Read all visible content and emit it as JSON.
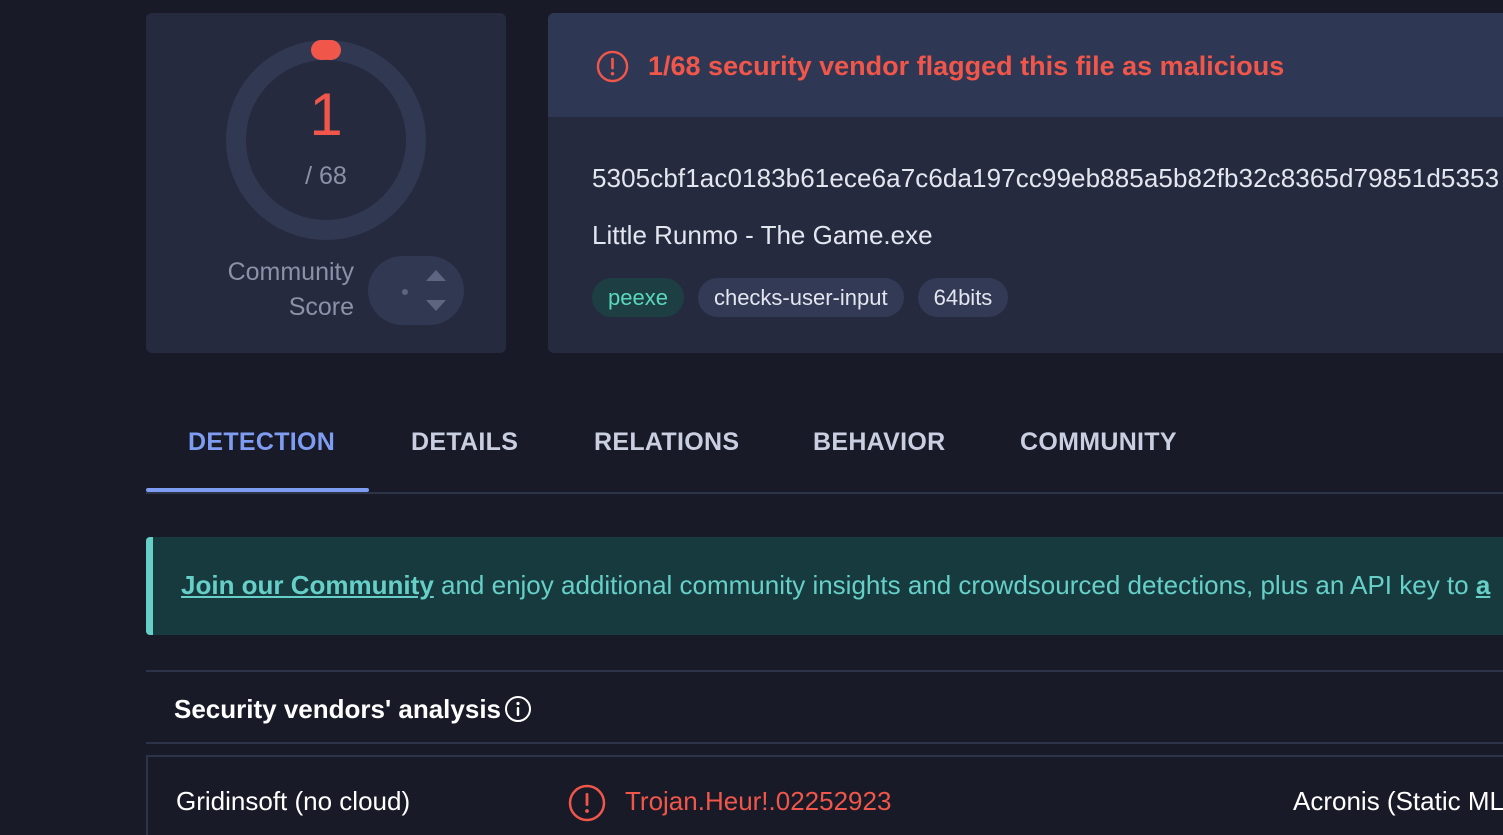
{
  "score": {
    "detections": "1",
    "total": "/ 68",
    "community_label_line1": "Community",
    "community_label_line2": "Score",
    "ring_color": "#f0564a"
  },
  "file": {
    "alert_text": "1/68 security vendor flagged this file as malicious",
    "hash": "5305cbf1ac0183b61ece6a7c6da197cc99eb885a5b82fb32c8365d79851d5353",
    "name": "Little Runmo - The Game.exe",
    "tags": [
      "peexe",
      "checks-user-input",
      "64bits"
    ]
  },
  "tabs": [
    "DETECTION",
    "DETAILS",
    "RELATIONS",
    "BEHAVIOR",
    "COMMUNITY"
  ],
  "active_tab": "DETECTION",
  "banner": {
    "link_text": "Join our Community",
    "text": " and enjoy additional community insights and crowdsourced detections, plus an API key to ",
    "trailing_link": "a"
  },
  "vendors": {
    "title": "Security vendors' analysis",
    "rows": [
      {
        "vendor": "Gridinsoft (no cloud)",
        "result": "Trojan.Heur!.02252923",
        "vendor2": "Acronis (Static ML)"
      }
    ]
  },
  "colors": {
    "malicious": "#f0564a",
    "accent": "#7e9cf2",
    "community": "#66d0c8"
  }
}
